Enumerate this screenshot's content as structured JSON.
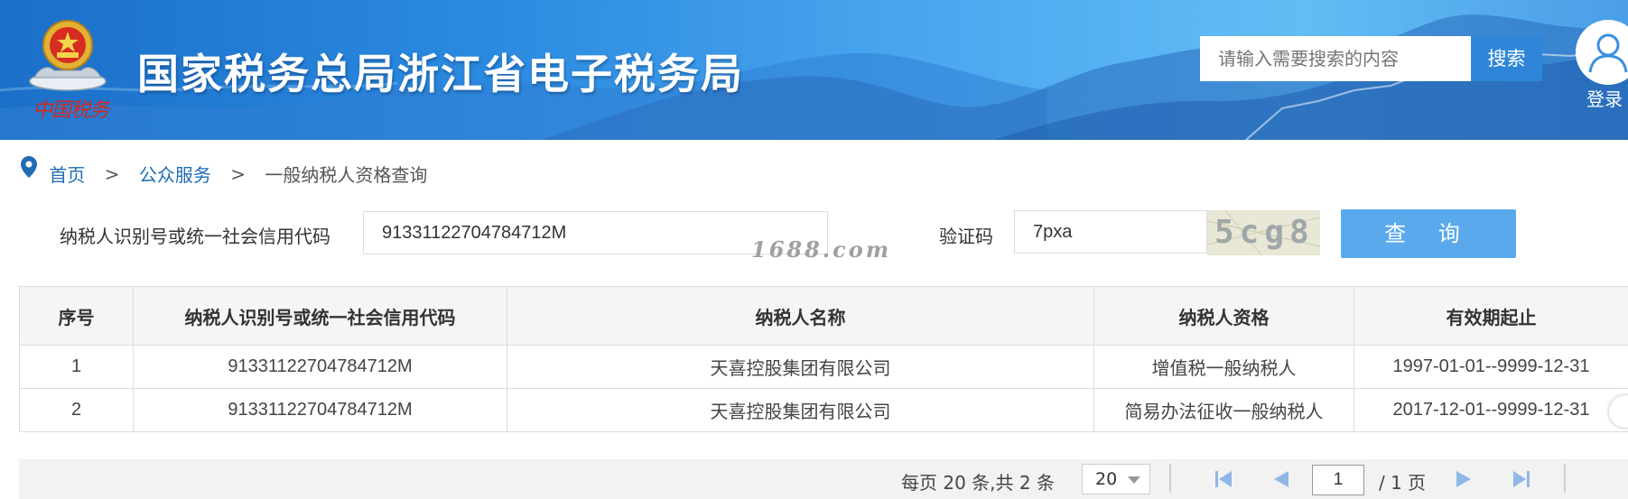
{
  "header": {
    "site_title": "国家税务总局浙江省电子税务局",
    "emblem_script": "中国税务",
    "search_placeholder": "请输入需要搜索的内容",
    "search_button": "搜索",
    "login_label": "登录"
  },
  "breadcrumb": {
    "home": "首页",
    "separator": ">",
    "public_service": "公众服务",
    "current": "一般纳税人资格查询"
  },
  "query_form": {
    "id_label": "纳税人识别号或统一社会信用代码",
    "id_value": "91331122704784712M",
    "captcha_label": "验证码",
    "captcha_value": "7pxa",
    "captcha_image_text": "5cg8",
    "query_button": "查 询"
  },
  "watermark": "1688.com",
  "table": {
    "headers": [
      "序号",
      "纳税人识别号或统一社会信用代码",
      "纳税人名称",
      "纳税人资格",
      "有效期起止"
    ],
    "rows": [
      [
        "1",
        "91331122704784712M",
        "天喜控股集团有限公司",
        "增值税一般纳税人",
        "1997-01-01--9999-12-31"
      ],
      [
        "2",
        "91331122704784712M",
        "天喜控股集团有限公司",
        "简易办法征收一般纳税人",
        "2017-12-01--9999-12-31"
      ]
    ]
  },
  "pager": {
    "summary": "每页 20 条,共 2 条",
    "page_size": "20",
    "current_page": "1",
    "total_pages": "/ 1 页"
  },
  "colors": {
    "header_blue": "#2b8ae0",
    "search_button": "#2f86d9",
    "query_button": "#5aa9ec",
    "link": "#1f6cb5",
    "emblem_red": "#d1281f"
  },
  "icons": [
    "national-emblem-icon",
    "user-avatar-icon",
    "location-pin-icon",
    "first-page-icon",
    "prev-page-icon",
    "next-page-icon",
    "last-page-icon"
  ]
}
